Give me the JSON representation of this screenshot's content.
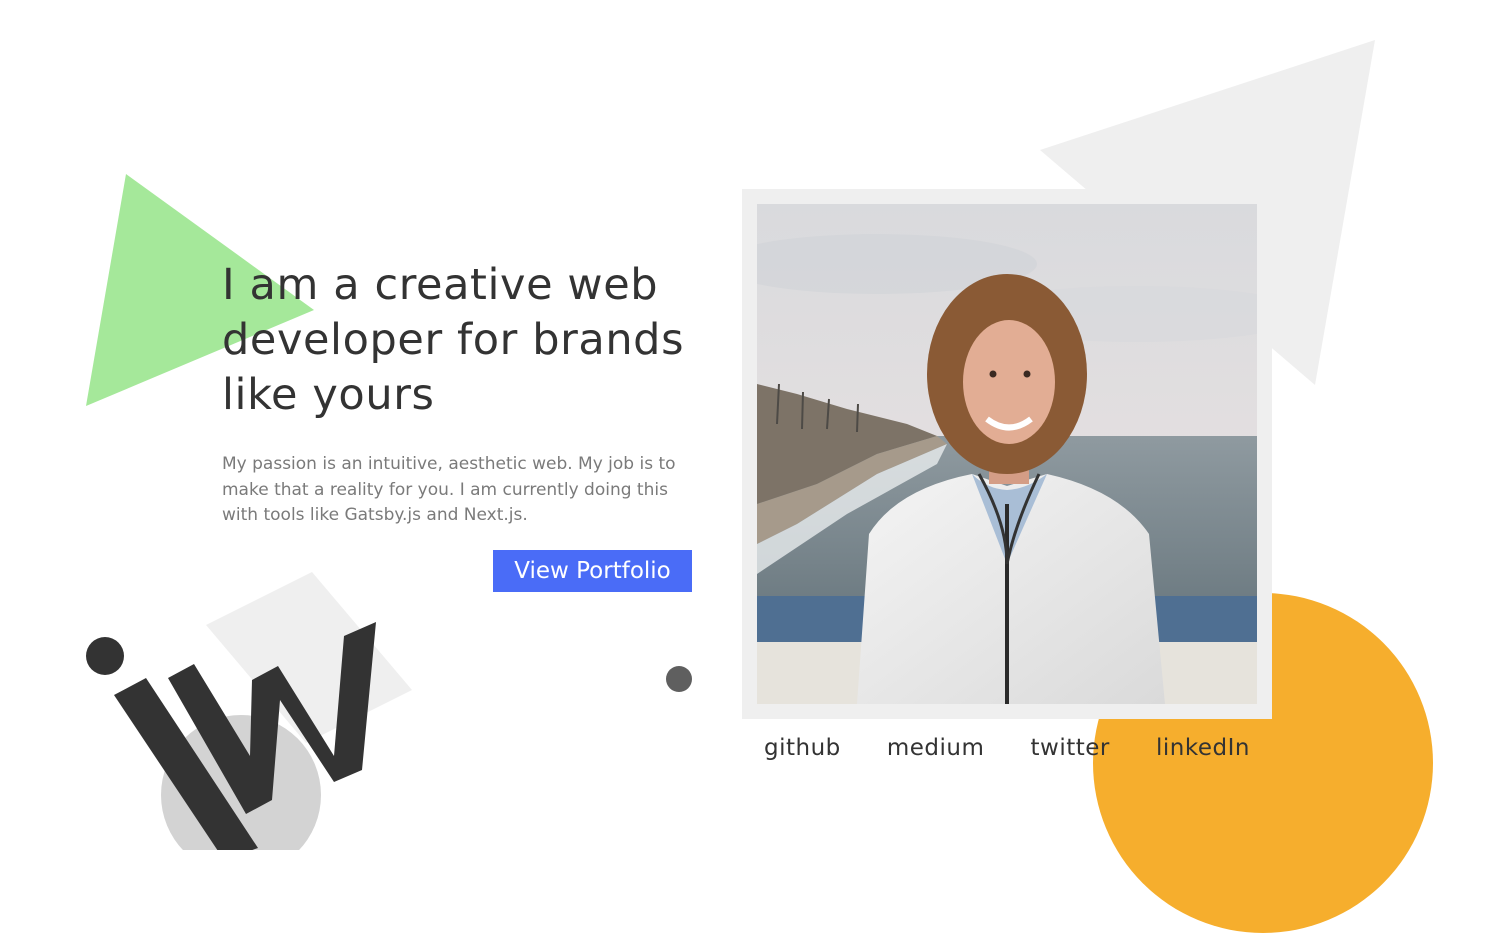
{
  "colors": {
    "accent_blue": "#4a6cf7",
    "green_shape": "#a5e89a",
    "gray_shape": "#efefef",
    "orange_shape": "#f6ae2d",
    "dark_dot": "#5f5f5f",
    "frame": "#efefef",
    "text_dark": "#333333",
    "text_muted": "#7a7a7a"
  },
  "hero": {
    "title": "I am a creative web developer for brands like yours",
    "description": "My passion is an intuitive, aesthetic web. My job is to make that a reality for you. I am currently doing this with tools like Gatsby.js and Next.js.",
    "cta_label": "View Portfolio"
  },
  "logo": {
    "text": "jw",
    "icon": "jw-logo-icon"
  },
  "photo": {
    "icon": "profile-photo"
  },
  "social": {
    "links": [
      {
        "label": "github"
      },
      {
        "label": "medium"
      },
      {
        "label": "twitter"
      },
      {
        "label": "linkedIn"
      }
    ]
  }
}
